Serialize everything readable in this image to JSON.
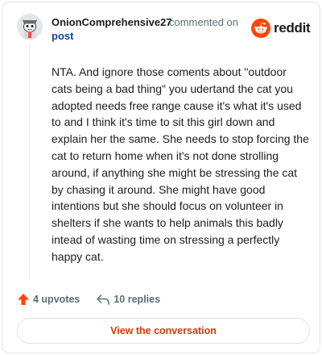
{
  "header": {
    "username": "OnionComprehensive27",
    "commented_on": "commented on",
    "post_link": "post",
    "brand": "reddit"
  },
  "comment": {
    "text": "NTA. And ignore those coments about \"outdoor cats being a bad thing\" you udertand the cat you adopted needs free range cause it's what it's used to and I think it's time to sit this girl down and explain her the same. She needs to stop forcing the cat to return home when it's not done strolling around, if anything she might be stressing the cat by chasing it around. She might have good intentions but she should focus on volunteer in shelters if she wants to help animals this badly intead of wasting time on stressing a perfectly happy cat."
  },
  "actions": {
    "upvotes": "4 upvotes",
    "replies": "10 replies"
  },
  "footer": {
    "button_label": "View the conversation"
  },
  "colors": {
    "brand_orange": "#ff4500",
    "link_blue": "#0a449b",
    "button_text": "#d93a00",
    "muted": "#576f76"
  },
  "icons": {
    "avatar": "snoo-avatar-icon",
    "logo": "reddit-logo-icon",
    "upvote": "upvote-arrow-icon",
    "reply": "reply-arrow-icon"
  }
}
